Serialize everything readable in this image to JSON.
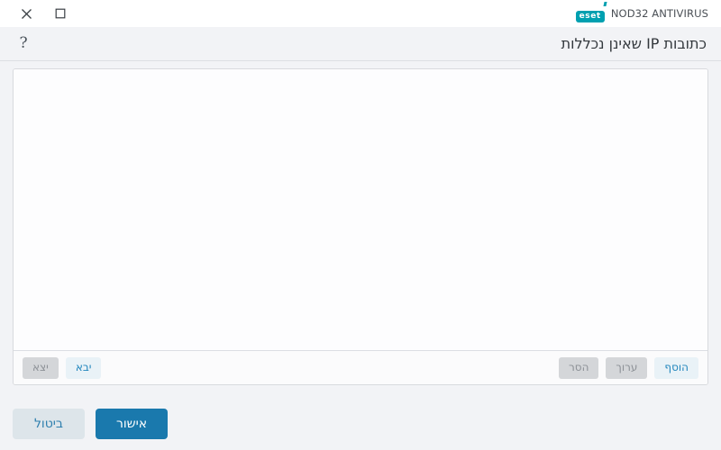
{
  "window": {
    "close_label": "✕",
    "maximize_label": "□",
    "close_icon_name": "close-icon",
    "maximize_icon_name": "maximize-icon"
  },
  "brand": {
    "logo_text": "eset",
    "product_name": "NOD32 ANTIVIRUS",
    "logo_color": "#00a0b0"
  },
  "header": {
    "help_label": "?",
    "title": "כתובות IP שאינן נכללות"
  },
  "list": {
    "items": [],
    "empty": true
  },
  "toolbar": {
    "left": [
      {
        "label": "יצא",
        "name": "export-button",
        "enabled": false
      },
      {
        "label": "יבא",
        "name": "import-button",
        "enabled": true
      }
    ],
    "right": [
      {
        "label": "הסר",
        "name": "remove-button",
        "enabled": false
      },
      {
        "label": "ערוך",
        "name": "edit-button",
        "enabled": false
      },
      {
        "label": "הוסף",
        "name": "add-button",
        "enabled": true
      }
    ]
  },
  "footer": {
    "cancel_label": "ביטול",
    "ok_label": "אישור"
  },
  "colors": {
    "accent": "#1a79ad",
    "accent_light": "#dde5ea",
    "brand_teal": "#00a0b0",
    "background": "#f2f3f6",
    "panel": "#ffffff",
    "link_blue": "#2186bd"
  }
}
